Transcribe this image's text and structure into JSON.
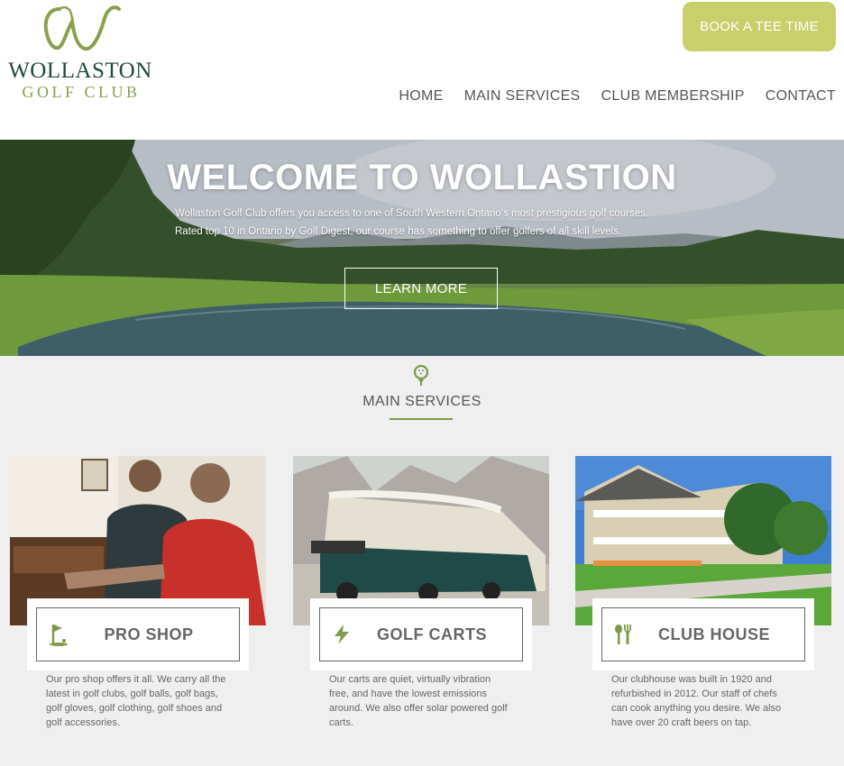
{
  "header": {
    "logo_mark": "W",
    "logo_name": "WOLLASTON",
    "logo_sub": "GOLF CLUB",
    "book_label": "BOOK A TEE TIME",
    "nav": [
      "HOME",
      "MAIN SERVICES",
      "CLUB MEMBERSHIP",
      "CONTACT"
    ]
  },
  "hero": {
    "title": "WELCOME TO WOLLASTION",
    "line1": "Wollaston Golf Club offers you access to one of South Western Ontario's most prestigious golf courses.",
    "line2": "Rated top 10 in Ontario by Golf Digest, our course has something to offer golfers of all skill levels.",
    "cta": "LEARN MORE"
  },
  "services": {
    "heading": "MAIN SERVICES",
    "accent": "#7f9a4a",
    "cards": [
      {
        "title": "PRO SHOP",
        "icon": "golf-flag-icon",
        "desc": "Our pro shop offers it all. We carry all the latest in golf clubs, golf balls, golf bags, golf gloves, golf clothing, golf shoes and golf accessories."
      },
      {
        "title": "GOLF CARTS",
        "icon": "lightning-icon",
        "desc": "Our carts are quiet, virtually vibration free, and have the lowest emissions around. We also offer solar powered golf carts."
      },
      {
        "title": "CLUB HOUSE",
        "icon": "fork-knife-icon",
        "desc": "Our clubhouse was built in 1920 and refurbished in 2012. Our staff of chefs can cook anything you desire. We also have over 20 craft beers on tap."
      }
    ]
  },
  "colors": {
    "button": "#c7d06a",
    "logo_dark": "#1f4a3a",
    "logo_light": "#8aa04f"
  }
}
